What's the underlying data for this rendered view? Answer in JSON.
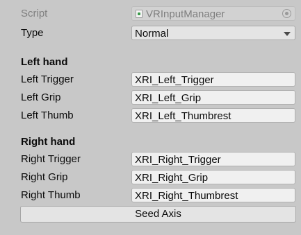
{
  "script_row": {
    "label": "Script",
    "value": "VRInputManager",
    "script_icon": "script-file-icon",
    "picker_icon": "object-picker-icon"
  },
  "type_row": {
    "label": "Type",
    "value": "Normal",
    "dropdown_icon": "chevron-down-icon"
  },
  "left_hand": {
    "header": "Left hand",
    "trigger": {
      "label": "Left Trigger",
      "value": "XRI_Left_Trigger"
    },
    "grip": {
      "label": "Left Grip",
      "value": "XRI_Left_Grip"
    },
    "thumb": {
      "label": "Left Thumb",
      "value": "XRI_Left_Thumbrest"
    }
  },
  "right_hand": {
    "header": "Right hand",
    "trigger": {
      "label": "Right Trigger",
      "value": "XRI_Right_Trigger"
    },
    "grip": {
      "label": "Right Grip",
      "value": "XRI_Right_Grip"
    },
    "thumb": {
      "label": "Right Thumb",
      "value": "XRI_Right_Thumbrest"
    }
  },
  "seed_button": {
    "label": "Seed Axis"
  },
  "colors": {
    "background": "#c8c8c8",
    "field": "#f0f0f0",
    "disabled_text": "#7f7f7f",
    "script_icon_accent": "#3b9a4a"
  }
}
